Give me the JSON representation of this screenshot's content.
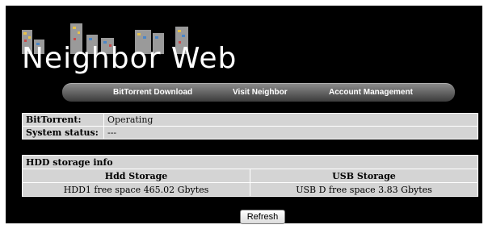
{
  "brand": {
    "name": "Neighbor Web"
  },
  "nav": {
    "items": [
      {
        "label": "BitTorrent Download"
      },
      {
        "label": "Visit Neighbor"
      },
      {
        "label": "Account Management"
      }
    ]
  },
  "status": {
    "rows": [
      {
        "label": "BitTorrent:",
        "value": "Operating"
      },
      {
        "label": "System status:",
        "value": "---"
      }
    ]
  },
  "storage": {
    "title": "HDD storage info",
    "columns": [
      "Hdd Storage",
      "USB Storage"
    ],
    "values": [
      "HDD1 free space 465.02 Gbytes",
      "USB D free space 3.83 Gbytes"
    ]
  },
  "actions": {
    "refresh_label": "Refresh"
  },
  "colors": {
    "background": "#000000",
    "table_bg": "#d4d4d4",
    "navbar": "#5a5a5a"
  }
}
